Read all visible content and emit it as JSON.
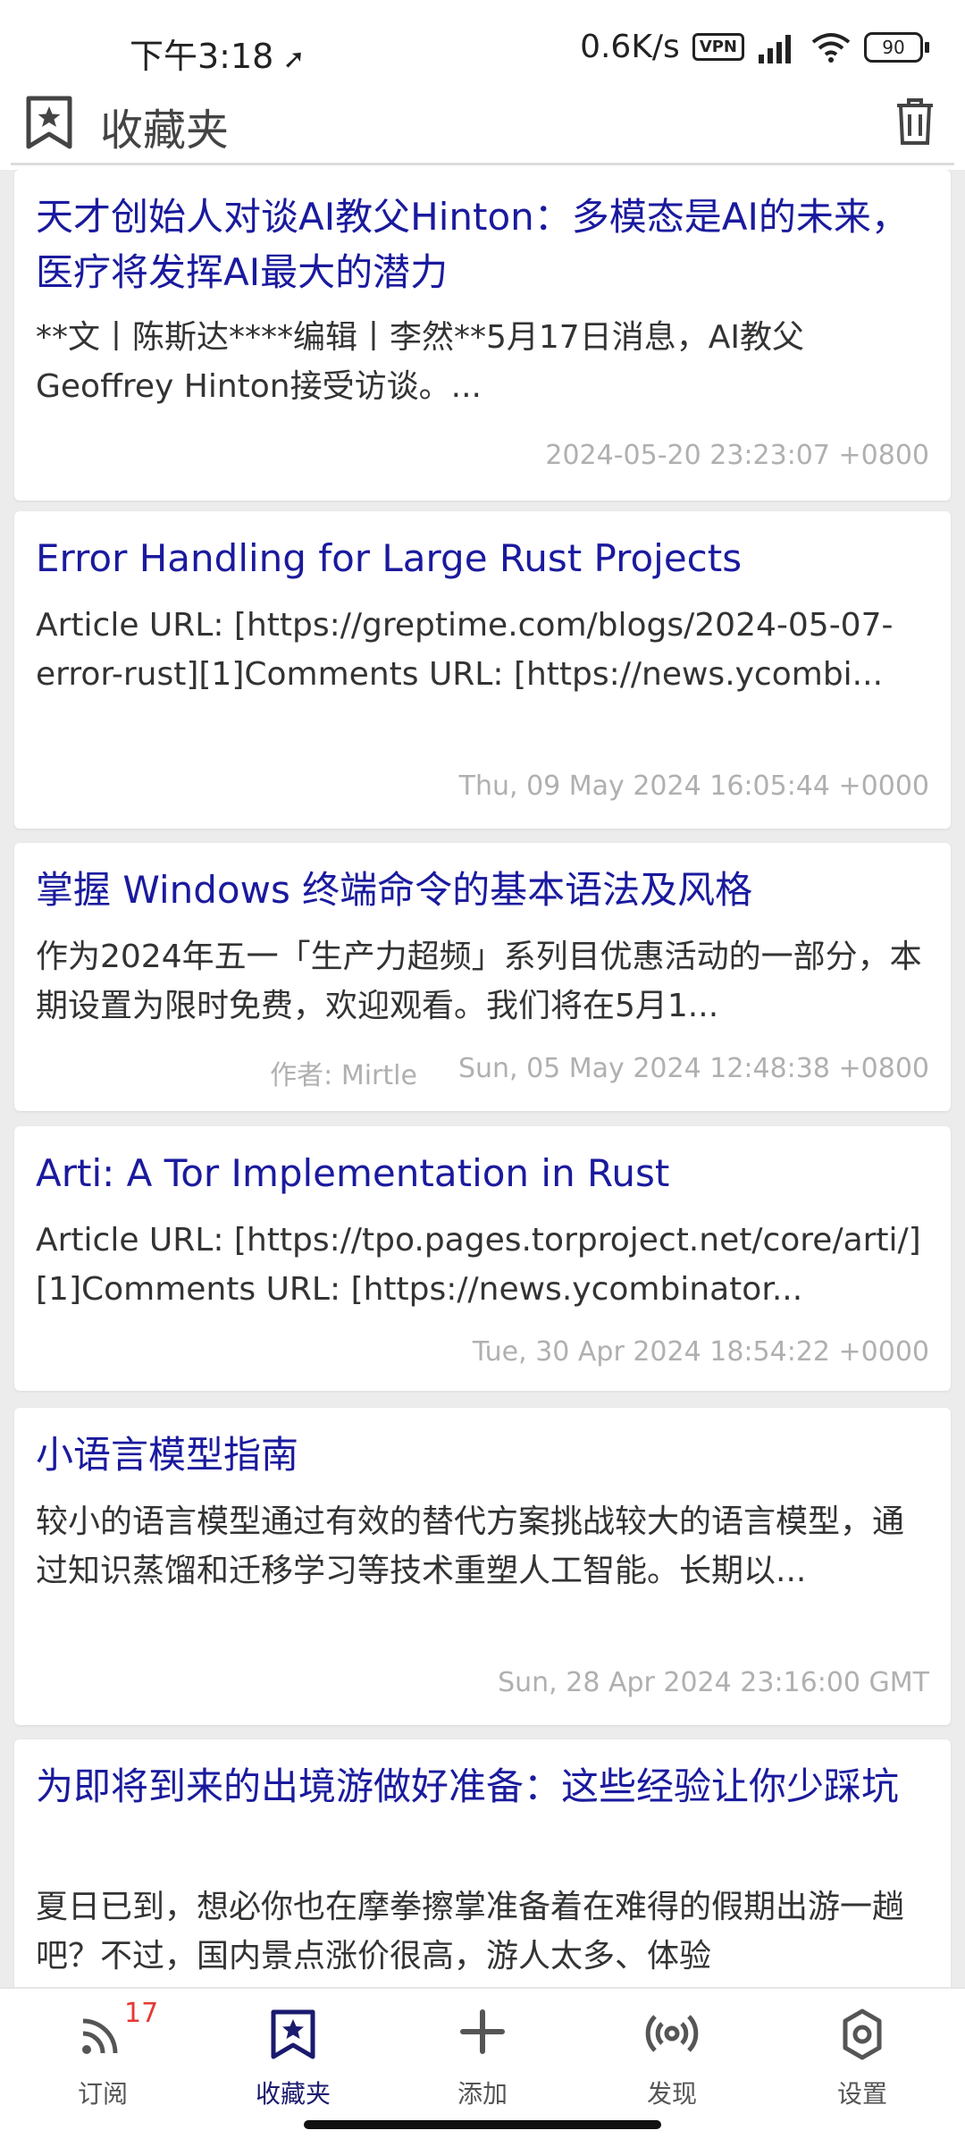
{
  "status_bar": {
    "time": "下午3:18",
    "net_speed": "0.6K/s",
    "vpn": "VPN",
    "battery": "90"
  },
  "header": {
    "title": "收藏夹"
  },
  "articles": [
    {
      "title": "天才创始人对谈AI教父Hinton：多模态是AI的未来，医疗将发挥AI最大的潜力",
      "summary": "**文丨陈斯达****编辑丨李然**5月17日消息，AI教父Geoffrey Hinton接受访谈。...",
      "author": "",
      "date": "2024-05-20 23:23:07  +0800"
    },
    {
      "title": "Error Handling for Large Rust Projects",
      "summary": "Article URL: [https://greptime.com/blogs/2024-05-07-error-rust][1]Comments URL: [https://news.ycombi...",
      "author": "",
      "date": "Thu, 09 May 2024 16:05:44 +0000"
    },
    {
      "title": "掌握 Windows 终端命令的基本语法及风格",
      "summary": "作为2024年五一「生产力超频」系列目优惠活动的一部分，本期设置为限时免费，欢迎观看。我们将在5月1...",
      "author": "作者: Mirtle",
      "date": "Sun, 05 May 2024 12:48:38 +0800"
    },
    {
      "title": "Arti: A Tor Implementation in Rust",
      "summary": "Article URL: [https://tpo.pages.torproject.net/core/arti/][1]Comments URL: [https://news.ycombinator...",
      "author": "",
      "date": "Tue, 30 Apr 2024 18:54:22 +0000"
    },
    {
      "title": "小语言模型指南",
      "summary": "较小的语言模型通过有效的替代方案挑战较大的语言模型，通过知识蒸馏和迁移学习等技术重塑人工智能。长期以...",
      "author": "",
      "date": "Sun, 28 Apr 2024 23:16:00 GMT"
    },
    {
      "title": "为即将到来的出境游做好准备：这些经验让你少踩坑",
      "summary": "夏日已到，想必你也在摩拳擦掌准备着在难得的假期出游一趟吧？不过，国内景点涨价很高，游人太多、体验",
      "author": "",
      "date": ""
    }
  ],
  "bottom_nav": [
    {
      "label": "订阅",
      "icon": "rss-icon",
      "badge": "17"
    },
    {
      "label": "收藏夹",
      "icon": "bookmark-star-icon",
      "badge": ""
    },
    {
      "label": "添加",
      "icon": "plus-icon",
      "badge": ""
    },
    {
      "label": "发现",
      "icon": "broadcast-icon",
      "badge": ""
    },
    {
      "label": "设置",
      "icon": "gear-icon",
      "badge": ""
    }
  ],
  "colors": {
    "title_blue": "#1a1a9e",
    "active_nav": "#1a1a6e",
    "badge_red": "#e53935",
    "list_bg": "#ececec"
  }
}
